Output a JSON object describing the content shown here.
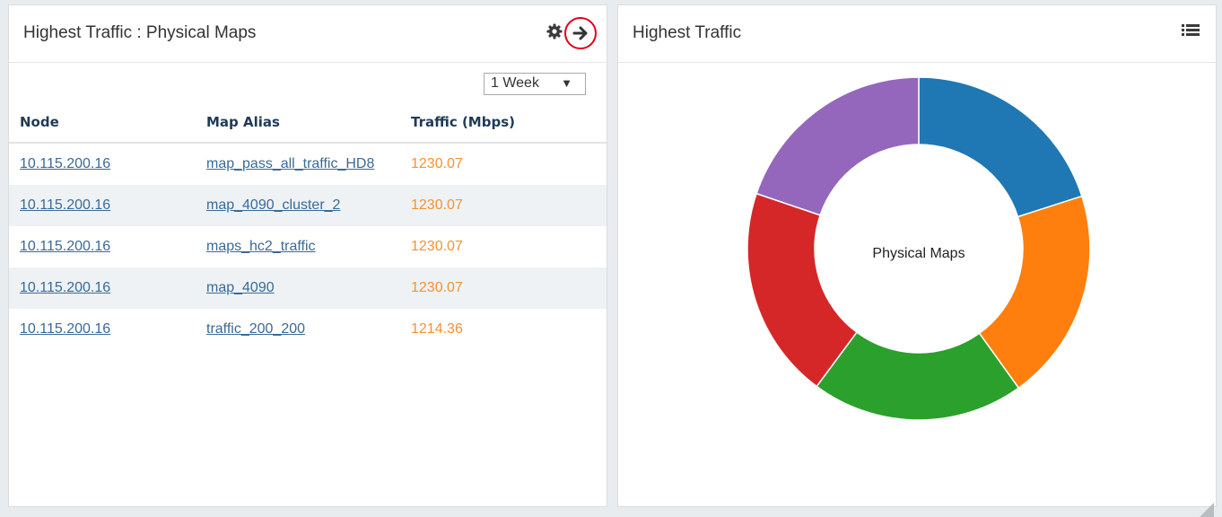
{
  "left_panel": {
    "title": "Highest Traffic : Physical Maps",
    "period": "1 Week",
    "columns": [
      "Node",
      "Map Alias",
      "Traffic (Mbps)"
    ],
    "rows": [
      {
        "node": "10.115.200.16",
        "alias": "map_pass_all_traffic_HD8",
        "traffic": "1230.07"
      },
      {
        "node": "10.115.200.16",
        "alias": "map_4090_cluster_2",
        "traffic": "1230.07"
      },
      {
        "node": "10.115.200.16",
        "alias": "maps_hc2_traffic",
        "traffic": "1230.07"
      },
      {
        "node": "10.115.200.16",
        "alias": "map_4090",
        "traffic": "1230.07"
      },
      {
        "node": "10.115.200.16",
        "alias": "traffic_200_200",
        "traffic": "1214.36"
      }
    ]
  },
  "right_panel": {
    "title": "Highest Traffic",
    "center_label": "Physical Maps"
  },
  "chart_data": {
    "type": "pie",
    "donut": true,
    "center_label": "Physical Maps",
    "categories": [
      "map_pass_all_traffic_HD8",
      "map_4090_cluster_2",
      "maps_hc2_traffic",
      "map_4090",
      "traffic_200_200"
    ],
    "values": [
      1230.07,
      1230.07,
      1230.07,
      1230.07,
      1214.36
    ],
    "colors": [
      "#1f77b4",
      "#ff7f0e",
      "#2ca02c",
      "#d62728",
      "#9467bd"
    ]
  },
  "colors": {
    "link": "#3a6a96",
    "traffic_value": "#f5922f",
    "header_text": "#1f3b56",
    "highlight_ring": "#e2001a"
  },
  "icons": {
    "settings": "gear-icon",
    "navigate": "arrow-right-icon",
    "list": "list-icon"
  }
}
